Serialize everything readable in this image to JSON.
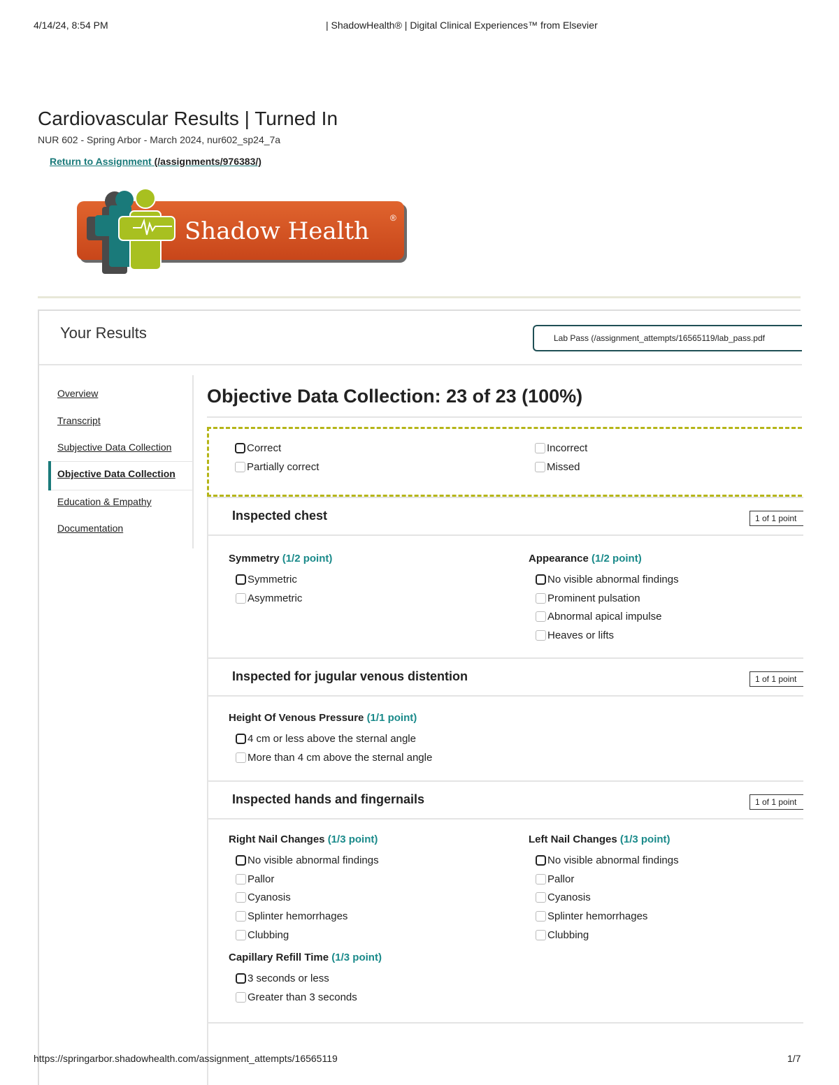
{
  "print_header": {
    "date": "4/14/24, 8:54 PM",
    "title": "| ShadowHealth® | Digital Clinical Experiences™ from Elsevier"
  },
  "print_footer": {
    "url": "https://springarbor.shadowhealth.com/assignment_attempts/16565119",
    "pages": "1/7"
  },
  "page": {
    "title": "Cardiovascular Results | Turned In",
    "subtitle": "NUR 602 - Spring Arbor - March 2024, nur602_sp24_7a",
    "return_label": "Return to Assignment",
    "return_path": "(/assignments/976383/)",
    "logo_text": "Shadow Health",
    "logo_colors": {
      "orange": "#d4501f",
      "green": "#a8c020",
      "gray": "#5a5a5a",
      "teal": "#1a7a7a"
    }
  },
  "results": {
    "heading": "Your Results",
    "lab_pass": "Lab Pass (/assignment_attempts/16565119/lab_pass.pdf"
  },
  "sidebar": {
    "items": [
      {
        "label": "Overview"
      },
      {
        "label": "Transcript"
      },
      {
        "label": "Subjective Data Collection"
      },
      {
        "label": "Objective Data Collection"
      },
      {
        "label": "Education & Empathy"
      },
      {
        "label": "Documentation"
      }
    ],
    "active_index": 3
  },
  "main": {
    "heading": "Objective Data Collection: 23 of 23 (100%)",
    "legend": {
      "correct": "Correct",
      "partially_correct": "Partially correct",
      "incorrect": "Incorrect",
      "missed": "Missed"
    },
    "sections": [
      {
        "title": "Inspected chest",
        "score": "1 of 1 point",
        "groups": [
          {
            "label": "Symmetry",
            "points": "(1/2 point)",
            "options": [
              "Symmetric",
              "Asymmetric"
            ]
          },
          {
            "label": "Appearance",
            "points": "(1/2 point)",
            "options": [
              "No visible abnormal findings",
              "Prominent pulsation",
              "Abnormal apical impulse",
              "Heaves or lifts"
            ]
          }
        ]
      },
      {
        "title": "Inspected for jugular venous distention",
        "score": "1 of 1 point",
        "groups": [
          {
            "label": "Height Of Venous Pressure",
            "points": "(1/1 point)",
            "options": [
              "4 cm or less above the sternal angle",
              "More than 4 cm above the sternal angle"
            ]
          }
        ]
      },
      {
        "title": "Inspected hands and fingernails",
        "score": "1 of 1 point",
        "groups": [
          {
            "label": "Right Nail Changes",
            "points": "(1/3 point)",
            "options": [
              "No visible abnormal findings",
              "Pallor",
              "Cyanosis",
              "Splinter hemorrhages",
              "Clubbing"
            ]
          },
          {
            "label": "Left Nail Changes",
            "points": "(1/3 point)",
            "options": [
              "No visible abnormal findings",
              "Pallor",
              "Cyanosis",
              "Splinter hemorrhages",
              "Clubbing"
            ]
          },
          {
            "label": "Capillary Refill Time",
            "points": "(1/3 point)",
            "options": [
              "3 seconds or less",
              "Greater than 3 seconds"
            ]
          }
        ]
      }
    ]
  }
}
